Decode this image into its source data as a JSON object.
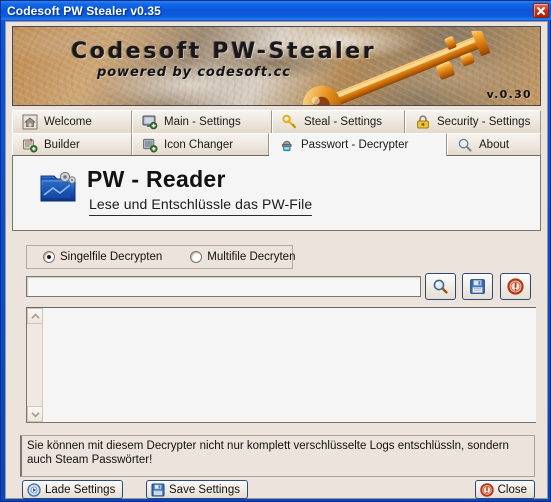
{
  "window": {
    "title": "Codesoft PW Stealer v0.35",
    "close_icon": "close-x-icon",
    "accent_color": "#0a54d8",
    "client_bg": "#ece4dc"
  },
  "banner": {
    "title": "Codesoft PW-Stealer",
    "subtitle": "powered by codesoft.cc",
    "version": "v.0.30",
    "art": "golden-key-icon"
  },
  "tabs": {
    "row1": [
      {
        "label": "Welcome",
        "icon": "home-icon",
        "active": false
      },
      {
        "label": "Main - Settings",
        "icon": "monitor-gear-icon",
        "active": false
      },
      {
        "label": "Steal - Settings",
        "icon": "key-icon",
        "active": false
      },
      {
        "label": "Security - Settings",
        "icon": "padlock-icon",
        "active": false
      }
    ],
    "row2": [
      {
        "label": "Builder",
        "icon": "build-gear-icon",
        "active": false
      },
      {
        "label": "Icon Changer",
        "icon": "image-swap-icon",
        "active": false
      },
      {
        "label": "Passwort - Decrypter",
        "icon": "decrypt-icon",
        "active": true
      },
      {
        "label": "About",
        "icon": "magnifier-icon",
        "active": false
      }
    ]
  },
  "panel": {
    "header": {
      "title": "PW - Reader",
      "subtitle": "Lese und Entschlüssle das PW-File",
      "icon": "open-folder-gear-icon"
    },
    "mode": {
      "selected": "single",
      "options": [
        {
          "id": "single",
          "label": "Singelfile Decrypten",
          "checked": true
        },
        {
          "id": "multi",
          "label": "Multifile Decryten",
          "checked": false
        }
      ]
    },
    "path_field": {
      "value": "",
      "placeholder": ""
    },
    "tool_buttons": [
      {
        "id": "browse",
        "icon": "magnifier-icon",
        "tooltip": "Browse"
      },
      {
        "id": "save",
        "icon": "floppy-disk-icon",
        "tooltip": "Save"
      },
      {
        "id": "info",
        "icon": "red-alert-icon",
        "tooltip": "Info"
      }
    ],
    "log": {
      "value": "",
      "placeholder": "",
      "scrollbar_side": "left"
    }
  },
  "status": {
    "message": "Sie können mit diesem Decrypter nicht nur komplett verschlüsselte Logs entschlüssln, sondern auch Steam Passwörter!"
  },
  "footer": {
    "buttons": [
      {
        "id": "load",
        "label": "Lade Settings",
        "icon": "disc-play-icon"
      },
      {
        "id": "save",
        "label": "Save Settings",
        "icon": "floppy-disk-icon"
      },
      {
        "id": "close",
        "label": "Close",
        "icon": "red-alert-icon"
      }
    ]
  }
}
